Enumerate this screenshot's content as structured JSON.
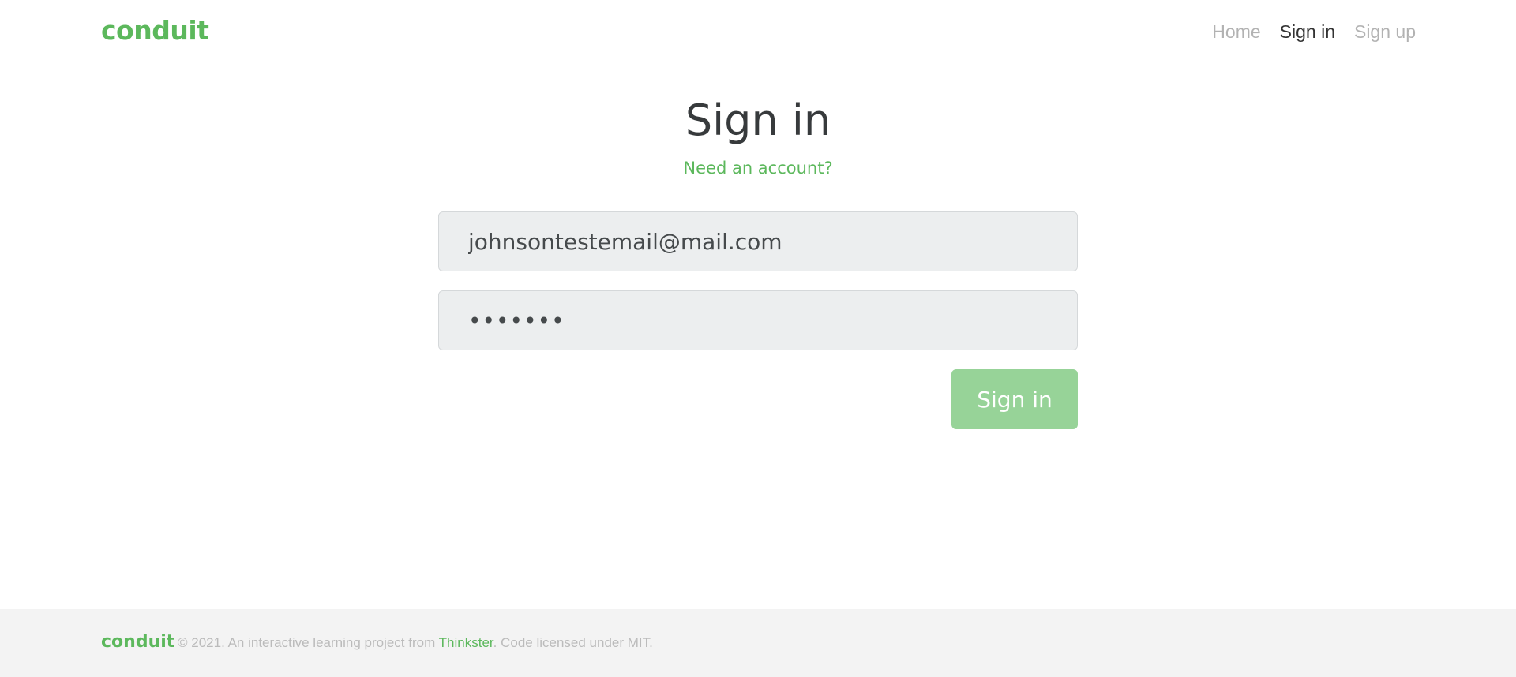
{
  "navbar": {
    "brand": "conduit",
    "links": [
      {
        "label": "Home",
        "active": false
      },
      {
        "label": "Sign in",
        "active": true
      },
      {
        "label": "Sign up",
        "active": false
      }
    ]
  },
  "auth": {
    "title": "Sign in",
    "switch_link": "Need an account?",
    "email_value": "johnsontestemail@mail.com",
    "password_value": "•••••••",
    "submit_label": "Sign in"
  },
  "footer": {
    "brand": "conduit",
    "attribution_prefix": "© 2021. An interactive learning project from ",
    "attribution_link": "Thinkster",
    "attribution_suffix": ". Code licensed under MIT."
  },
  "colors": {
    "brand": "#5cb85c",
    "button_disabled": "#97d398",
    "input_bg": "#eceeef",
    "footer_bg": "#f3f3f3"
  }
}
